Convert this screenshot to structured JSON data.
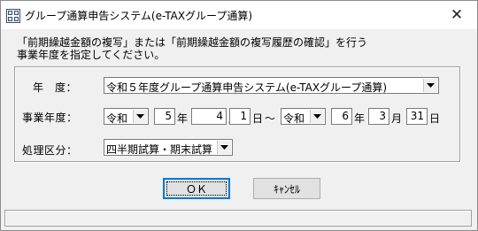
{
  "window": {
    "title": "グループ通算申告システム(e-TAXグループ通算)",
    "close_glyph": "✕"
  },
  "message": {
    "line1": "「前期繰越金額の複写」または「前期繰越金額の複写履歴の確認」を行う",
    "line2": "事業年度を指定してください。"
  },
  "form": {
    "year_label": "年　度：",
    "year_value": "令和５年度グループ通算申告システム(e-TAXグループ通算)",
    "period_label": "事業年度：",
    "start": {
      "era": "令和",
      "year": "5",
      "month": "4",
      "day": "1"
    },
    "tilde": "～",
    "end": {
      "era": "令和",
      "year": "6",
      "month": "3",
      "day": "31"
    },
    "unit_year": "年",
    "unit_month": "月",
    "unit_day": "日",
    "kind_label": "処理区分：",
    "kind_value": "四半期試算・期末試算"
  },
  "buttons": {
    "ok": "ＯＫ",
    "cancel": "ｷｬﾝｾﾙ"
  },
  "status": {
    "text": ""
  }
}
